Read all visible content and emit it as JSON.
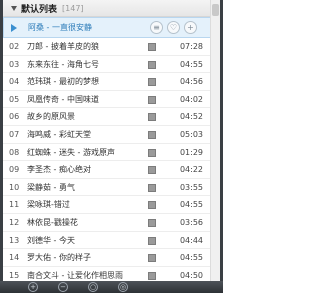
{
  "playlist": {
    "title": "默认列表",
    "count": "[147]"
  },
  "songs": [
    {
      "num": "",
      "title": "阿桑 - 一直很安静",
      "duration": ""
    },
    {
      "num": "02",
      "title": "刀郎 - 披着羊皮的狼",
      "duration": "07:28"
    },
    {
      "num": "03",
      "title": "东来东往 - 海角七号",
      "duration": "04:55"
    },
    {
      "num": "04",
      "title": "范玮琪 - 最初的梦想",
      "duration": "04:56"
    },
    {
      "num": "05",
      "title": "凤凰传奇 - 中国味道",
      "duration": "04:02"
    },
    {
      "num": "06",
      "title": "故乡的原风景",
      "duration": "04:52"
    },
    {
      "num": "07",
      "title": "海鸣威 - 彩虹天堂",
      "duration": "05:03"
    },
    {
      "num": "08",
      "title": "红蜘蛛 - 迷失 - 游戏原声",
      "duration": "01:29"
    },
    {
      "num": "09",
      "title": "李圣杰 - 痴心绝对",
      "duration": "04:22"
    },
    {
      "num": "10",
      "title": "梁静茹 - 勇气",
      "duration": "03:55"
    },
    {
      "num": "11",
      "title": "梁咏琪-错过",
      "duration": "04:55"
    },
    {
      "num": "12",
      "title": "林依昆-戳操花",
      "duration": "03:56"
    },
    {
      "num": "13",
      "title": "刘德华 - 今天",
      "duration": "04:44"
    },
    {
      "num": "14",
      "title": "罗大佑 - 你的样子",
      "duration": "04:55"
    },
    {
      "num": "15",
      "title": "南合文斗 - 让爱化作相思雨",
      "duration": "04:50"
    }
  ],
  "icons": {
    "play": "play-indicator-icon",
    "square": "song-action-square-icon",
    "heart": "heart-icon",
    "add": "add-icon"
  },
  "colors": {
    "active_row": "#e4f1fb",
    "active_text": "#2a7ab8",
    "dark_frame": "#3a3f44"
  }
}
